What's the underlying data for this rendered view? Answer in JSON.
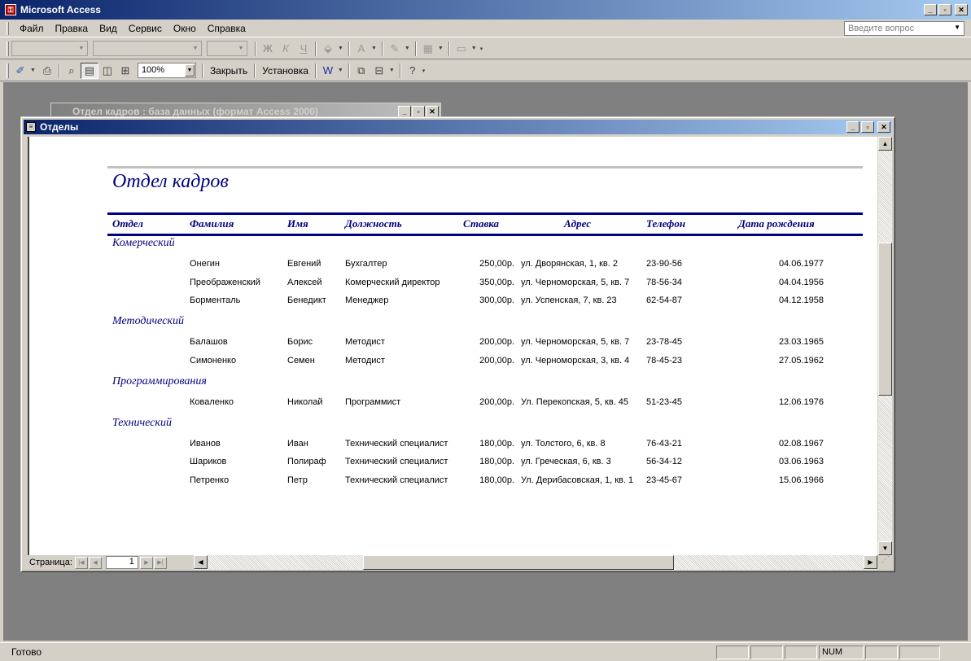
{
  "app": {
    "title": "Microsoft Access",
    "icon": "access-key-icon"
  },
  "menu": [
    "Файл",
    "Правка",
    "Вид",
    "Сервис",
    "Окно",
    "Справка"
  ],
  "ask_placeholder": "Введите вопрос",
  "toolbar_format": {
    "bold": "Ж",
    "italic": "К",
    "underline": "Ч"
  },
  "toolbar_preview": {
    "zoom": "100%",
    "close_label": "Закрыть",
    "setup_label": "Установка"
  },
  "background_window": {
    "title": "Отдел кадров : база данных (формат Access 2000)"
  },
  "report_window": {
    "title": "Отделы",
    "page_label": "Страница:",
    "page_number": "1"
  },
  "report": {
    "title": "Отдел кадров",
    "columns": [
      "Отдел",
      "Фамилия",
      "Имя",
      "Должность",
      "Ставка",
      "Адрес",
      "Телефон",
      "Дата рождения"
    ],
    "groups": [
      {
        "name": "Комерческий",
        "rows": [
          [
            "Онегин",
            "Евгений",
            "Бухгалтер",
            "250,00р.",
            "ул. Дворянская, 1, кв. 2",
            "23-90-56",
            "04.06.1977"
          ],
          [
            "Преображенский",
            "Алексей",
            "Комерческий директор",
            "350,00р.",
            "ул. Черноморская, 5, кв. 7",
            "78-56-34",
            "04.04.1956"
          ],
          [
            "Борменталь",
            "Бенедикт",
            "Менеджер",
            "300,00р.",
            "ул. Успенская, 7, кв. 23",
            "62-54-87",
            "04.12.1958"
          ]
        ]
      },
      {
        "name": "Методический",
        "rows": [
          [
            "Балашов",
            "Борис",
            "Методист",
            "200,00р.",
            "ул. Черноморская, 5, кв. 7",
            "23-78-45",
            "23.03.1965"
          ],
          [
            "Симоненко",
            "Семен",
            "Методист",
            "200,00р.",
            "ул. Черноморская, 3, кв. 4",
            "78-45-23",
            "27.05.1962"
          ]
        ]
      },
      {
        "name": "Программирования",
        "rows": [
          [
            "Коваленко",
            "Николай",
            "Программист",
            "200,00р.",
            "Ул. Перекопская, 5, кв. 45",
            "51-23-45",
            "12.06.1976"
          ]
        ]
      },
      {
        "name": "Технический",
        "rows": [
          [
            "Иванов",
            "Иван",
            "Технический специалист",
            "180,00р.",
            "ул. Толстого, 6, кв. 8",
            "76-43-21",
            "02.08.1967"
          ],
          [
            "Шариков",
            "Полираф",
            "Технический специалист",
            "180,00р.",
            "ул. Греческая, 6, кв. 3",
            "56-34-12",
            "03.06.1963"
          ],
          [
            "Петренко",
            "Петр",
            "Технический специалист",
            "180,00р.",
            "Ул. Дерибасовская, 1, кв. 1",
            "23-45-67",
            "15.06.1966"
          ]
        ]
      }
    ]
  },
  "status": {
    "text": "Готово",
    "num": "NUM"
  }
}
